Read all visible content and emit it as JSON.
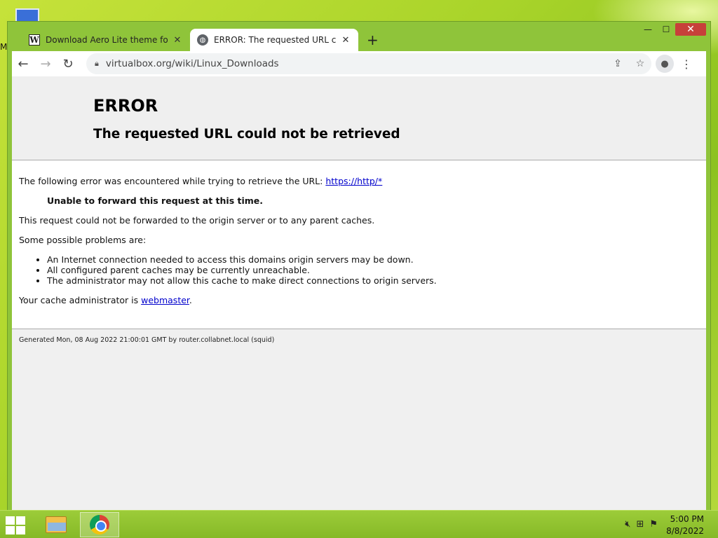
{
  "desktop": {
    "icon_label": "M"
  },
  "window": {
    "tabs": [
      {
        "title": "Download Aero Lite theme for W",
        "favicon": "W",
        "close": "✕"
      },
      {
        "title": "ERROR: The requested URL could",
        "favicon": "globe",
        "close": "✕"
      }
    ],
    "new_tab": "+",
    "controls": {
      "minimize": "—",
      "maximize": "☐",
      "close": "✕"
    }
  },
  "toolbar": {
    "back": "←",
    "forward": "→",
    "reload": "↻",
    "url": "virtualbox.org/wiki/Linux_Downloads",
    "share": "⇪",
    "star": "☆",
    "menu": "⋮"
  },
  "page": {
    "heading": "ERROR",
    "subheading": "The requested URL could not be retrieved",
    "intro": "The following error was encountered while trying to retrieve the URL: ",
    "intro_link": "https://http/*",
    "error_title": "Unable to forward this request at this time.",
    "detail": "This request could not be forwarded to the origin server or to any parent caches.",
    "problems_label": "Some possible problems are:",
    "problems": [
      "An Internet connection needed to access this domains origin servers may be down.",
      "All configured parent caches may be currently unreachable.",
      "The administrator may not allow this cache to make direct connections to origin servers."
    ],
    "admin_prefix": "Your cache administrator is ",
    "admin_link": "webmaster",
    "admin_suffix": ".",
    "footer": "Generated Mon, 08 Aug 2022 21:00:01 GMT by router.collabnet.local (squid)"
  },
  "taskbar": {
    "time": "5:00 PM",
    "date": "8/8/2022"
  }
}
